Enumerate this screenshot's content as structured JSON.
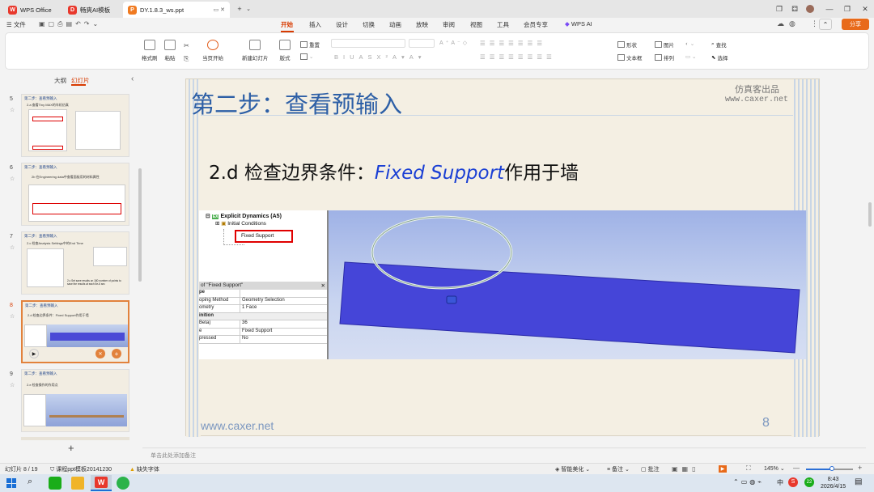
{
  "tabs": [
    {
      "label": "WPS Office",
      "icon": "wps-icon",
      "color": "#e8382c"
    },
    {
      "label": "畅爽AI模板",
      "icon": "template-icon",
      "color": "#e8382c"
    },
    {
      "label": "DY.1.8.3_ws.ppt",
      "icon": "ppt-icon",
      "color": "#f07a20"
    }
  ],
  "menu": {
    "file": "文件",
    "items": [
      "开始",
      "插入",
      "设计",
      "切换",
      "动画",
      "放映",
      "审阅",
      "视图",
      "工具",
      "会员专享",
      "WPS AI"
    ],
    "active": "开始",
    "share": "分享"
  },
  "ribbon": {
    "format_painter": "格式刷",
    "paste": "粘贴",
    "play_current": "当页开始",
    "new_slide": "新建幻灯片",
    "layout": "版式",
    "reset": "重置",
    "shape": "形状",
    "picture": "图片",
    "textbox": "文本框",
    "arrange": "排列",
    "find": "查找",
    "select": "选择"
  },
  "panel": {
    "outline": "大纲",
    "slides": "幻灯片"
  },
  "thumbs": [
    {
      "num": "5",
      "title": "第二步：查看预输入",
      "sub": "2.a 查看Tiny MAX的车机仿真"
    },
    {
      "num": "6",
      "title": "第二步：查看预输入",
      "sub": "2b 在Engineering data中查看面板用的材料属性"
    },
    {
      "num": "7",
      "title": "第二步：查看预输入",
      "sub": "2.c 检查Analysis Settings中的End Time"
    },
    {
      "num": "8",
      "title": "第二步：查看预输入",
      "sub": "2.d 检查边界条件：Fixed Support作用于墙"
    },
    {
      "num": "9",
      "title": "第二步：查看预输入",
      "sub": "2.e 检查操作的作用点"
    }
  ],
  "slide": {
    "title": "第二步：查看预输入",
    "watermark1": "仿真客出品",
    "watermark2": "www.caxer.net",
    "subtitle_a": "2.d  检查边界条件：",
    "subtitle_b": "Fixed Support",
    "subtitle_c": "作用于墙",
    "footer_url": "www.caxer.net",
    "page_no": "8",
    "tree": {
      "root": "Explicit Dynamics (A5)",
      "child1": "Initial Conditions",
      "child2": "Fixed Support"
    },
    "details_title": "of \"Fixed Support\"",
    "details": [
      {
        "k": "pe",
        "v": ""
      },
      {
        "k": "oping Method",
        "v": "Geometry Selection"
      },
      {
        "k": "ometry",
        "v": "1 Face"
      },
      {
        "k": "inition",
        "v": ""
      },
      {
        "k": "Beta)",
        "v": "36"
      },
      {
        "k": "e",
        "v": "Fixed Support"
      },
      {
        "k": "pressed",
        "v": "No"
      }
    ],
    "thumb7_note": "2.c Set save results on 180 number of points to save the results at each 5e-6 sec"
  },
  "notes_placeholder": "单击此处添加备注",
  "status": {
    "slide_pos": "幻灯片 8 / 19",
    "template": "课程ppt模板20141230",
    "missing_font": "缺失字体",
    "beautify": "智能美化",
    "notes": "备注",
    "comments": "批注",
    "zoom": "145%"
  },
  "taskbar": {
    "time": "8:43",
    "date": "2026/4/15",
    "ime": "中",
    "badge": "22"
  },
  "colors": {
    "accent": "#d83b01",
    "title_blue": "#2d5fa6",
    "support_blue": "#1a3fd4"
  }
}
